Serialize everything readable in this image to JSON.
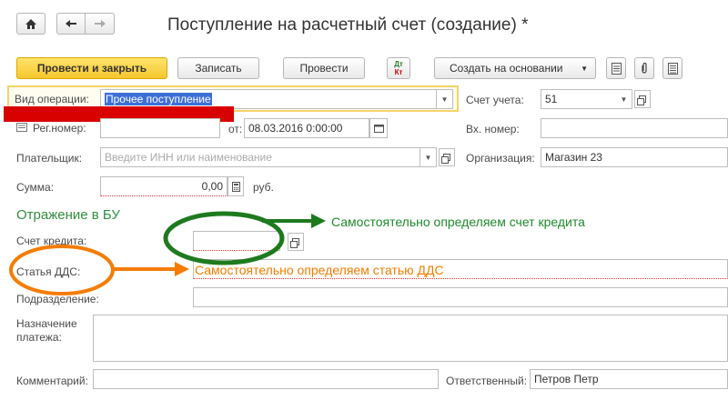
{
  "nav": {
    "home_icon": "home-icon",
    "back_icon": "arrow-left-icon",
    "forward_icon": "arrow-right-icon"
  },
  "title": "Поступление на расчетный счет (создание) *",
  "toolbar": {
    "post_close": "Провести и закрыть",
    "save": "Записать",
    "post": "Провести",
    "dtkt_top": "Дт",
    "dtkt_bottom": "Кт",
    "create_based": "Создать на основании"
  },
  "form": {
    "op_type_label": "Вид операции:",
    "op_type_value": "Прочее поступление",
    "account_label": "Счет учета:",
    "account_value": "51",
    "reg_label": "Рег.номер:",
    "from_label": "от:",
    "date_value": "08.03.2016  0:00:00",
    "in_num_label": "Вх. номер:",
    "payer_label": "Плательщик:",
    "payer_placeholder": "Введите ИНН или наименование",
    "org_label": "Организация:",
    "org_value": "Магазин 23",
    "sum_label": "Сумма:",
    "sum_value": "0,00",
    "currency": "руб.",
    "bu_section": "Отражение в БУ",
    "credit_account_label": "Счет кредита:",
    "dds_label": "Статья ДДС:",
    "division_label": "Подразделение:",
    "purpose_label_1": "Назначение",
    "purpose_label_2": "платежа:",
    "comment_label": "Комментарий:",
    "responsible_label": "Ответственный:",
    "responsible_value": "Петров Петр"
  },
  "annotations": {
    "credit_note": "Самостоятельно определяем счет кредита",
    "dds_note": "Самостоятельно определяем статью ДДС"
  },
  "colors": {
    "green_annotation": "#1e8a2a",
    "orange_annotation": "#f57c00",
    "redaction": "#d90000",
    "primary_button": "#f5c72e"
  }
}
